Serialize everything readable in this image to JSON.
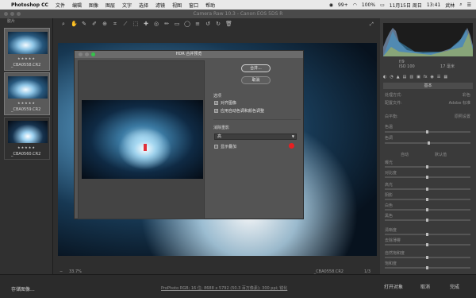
{
  "menubar": {
    "app": "Photoshop CC",
    "menus": [
      "文件",
      "编辑",
      "图像",
      "图层",
      "文字",
      "选择",
      "滤镜",
      "视图",
      "窗口",
      "帮助"
    ],
    "battery": "99+",
    "battery_pct": "100%",
    "date": "11月15日 周日",
    "time": "13:41",
    "user": "武林"
  },
  "window": {
    "title": "Camera Raw 10.3  -  Canon EOS 5DS R"
  },
  "filmstrip": {
    "header": "胶片",
    "items": [
      {
        "name": "_CBA0558.CR2",
        "stars": "★★★★★"
      },
      {
        "name": "_CBA0559.CR2",
        "stars": "★★★★★"
      },
      {
        "name": "_CBA0560.CR2",
        "stars": "★★★★★"
      }
    ]
  },
  "zoom": {
    "level": "33.7%",
    "filename": "_CBA0558.CR2",
    "page": "1/3"
  },
  "panel": {
    "camera_readout": {
      "r1": "f/9",
      "r2": "ISO 100",
      "r3": "17 毫米"
    },
    "section": "基本",
    "rows": [
      {
        "label": "处理方式:",
        "value": "彩色"
      },
      {
        "label": "配置文件:",
        "value": "Adobe 标准"
      },
      {
        "label": "白平衡:",
        "value": "原照设置"
      },
      {
        "label": "色温",
        "value": ""
      },
      {
        "label": "色调",
        "value": ""
      },
      {
        "label": "自动",
        "value": "默认值"
      },
      {
        "label": "曝光",
        "value": ""
      },
      {
        "label": "对比度",
        "value": ""
      },
      {
        "label": "高光",
        "value": ""
      },
      {
        "label": "阴影",
        "value": ""
      },
      {
        "label": "白色",
        "value": ""
      },
      {
        "label": "黑色",
        "value": ""
      },
      {
        "label": "清晰度",
        "value": ""
      },
      {
        "label": "去除薄雾",
        "value": ""
      },
      {
        "label": "自然饱和度",
        "value": ""
      },
      {
        "label": "饱和度",
        "value": ""
      }
    ]
  },
  "dialog": {
    "title": "HDR 合并预览",
    "merge_button": "合并...",
    "cancel_button": "取消",
    "options_label": "选项",
    "align_images": "对齐图像",
    "auto_tone": "应用自动色调和颜色调整",
    "deghost_label": "消除重影",
    "deghost_value": "高",
    "show_overlay": "显示叠加"
  },
  "bottombar": {
    "save_button": "存储图像...",
    "info": "ProPhoto RGB; 16 位; 8688 x 5792 (50.3 百万像素); 300 ppi; 锐化",
    "open_button": "打开对象",
    "cancel_button": "取消",
    "done_button": "完成"
  }
}
